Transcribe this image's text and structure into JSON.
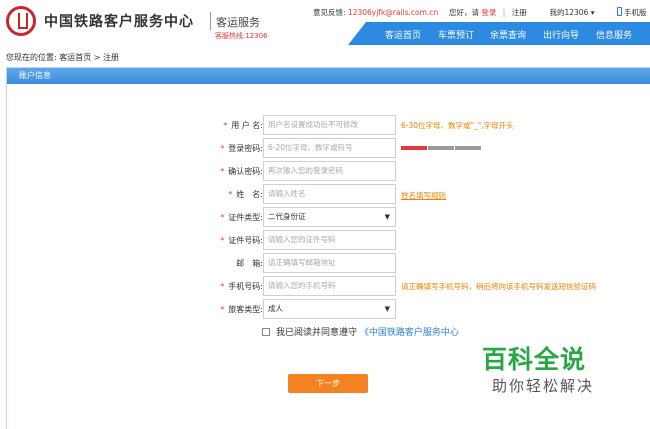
{
  "header": {
    "brand": "中国铁路客户服务中心",
    "subbrand": "客运服务",
    "hotline": "客服热线:12306",
    "feedback_label": "意见反馈:",
    "feedback_email": "12306yjfk@rails.com.cn",
    "greeting": "您好，请",
    "login": "登录",
    "register": "注册",
    "my12306": "我的12306",
    "mobile": "手机版"
  },
  "nav": {
    "items": [
      "客运首页",
      "车票预订",
      "余票查询",
      "出行向导",
      "信息服务"
    ]
  },
  "breadcrumb": {
    "prefix": "您现在的位置:",
    "home": "客运首页",
    "separator": ">",
    "current": "注册"
  },
  "panel": {
    "title": "账户信息"
  },
  "form": {
    "username": {
      "label": "用 户 名:",
      "placeholder": "用户名设置成功后不可修改",
      "hint": "6-30位字母、数字或\"_\",字母开头"
    },
    "password": {
      "label": "登录密码:",
      "placeholder": "6-20位字母、数字或符号"
    },
    "confirm": {
      "label": "确认密码:",
      "placeholder": "再次输入您的登录密码"
    },
    "name": {
      "label": "姓　名:",
      "placeholder": "请输入姓名",
      "hint": "姓名填写规则"
    },
    "id_type": {
      "label": "证件类型:",
      "value": "二代身份证"
    },
    "id_number": {
      "label": "证件号码:",
      "placeholder": "请输入您的证件号码"
    },
    "email": {
      "label": "邮　箱:",
      "placeholder": "请正确填写邮箱地址"
    },
    "phone": {
      "label": "手机号码:",
      "placeholder": "请输入您的手机号码",
      "hint": "请正确填写手机号码，稍后将向该手机号码发送短信验证码"
    },
    "passenger_type": {
      "label": "旅客类型:",
      "value": "成人"
    },
    "agree_text": "我已阅读并同意遵守",
    "agree_link": "《中国铁路客户服务中心",
    "next_button": "下一步"
  },
  "watermark": {
    "title": "百科全说",
    "subtitle": "助你轻松解决"
  },
  "colors": {
    "nav_blue": "#2c8ae0",
    "accent_red": "#e4393c",
    "hint_orange": "#f08200",
    "button_orange": "#f58220",
    "link_blue": "#2c7fd1"
  },
  "icons": {
    "logo": "railway-logo-icon",
    "dropdown": "caret-down-icon",
    "mobile": "phone-icon"
  }
}
